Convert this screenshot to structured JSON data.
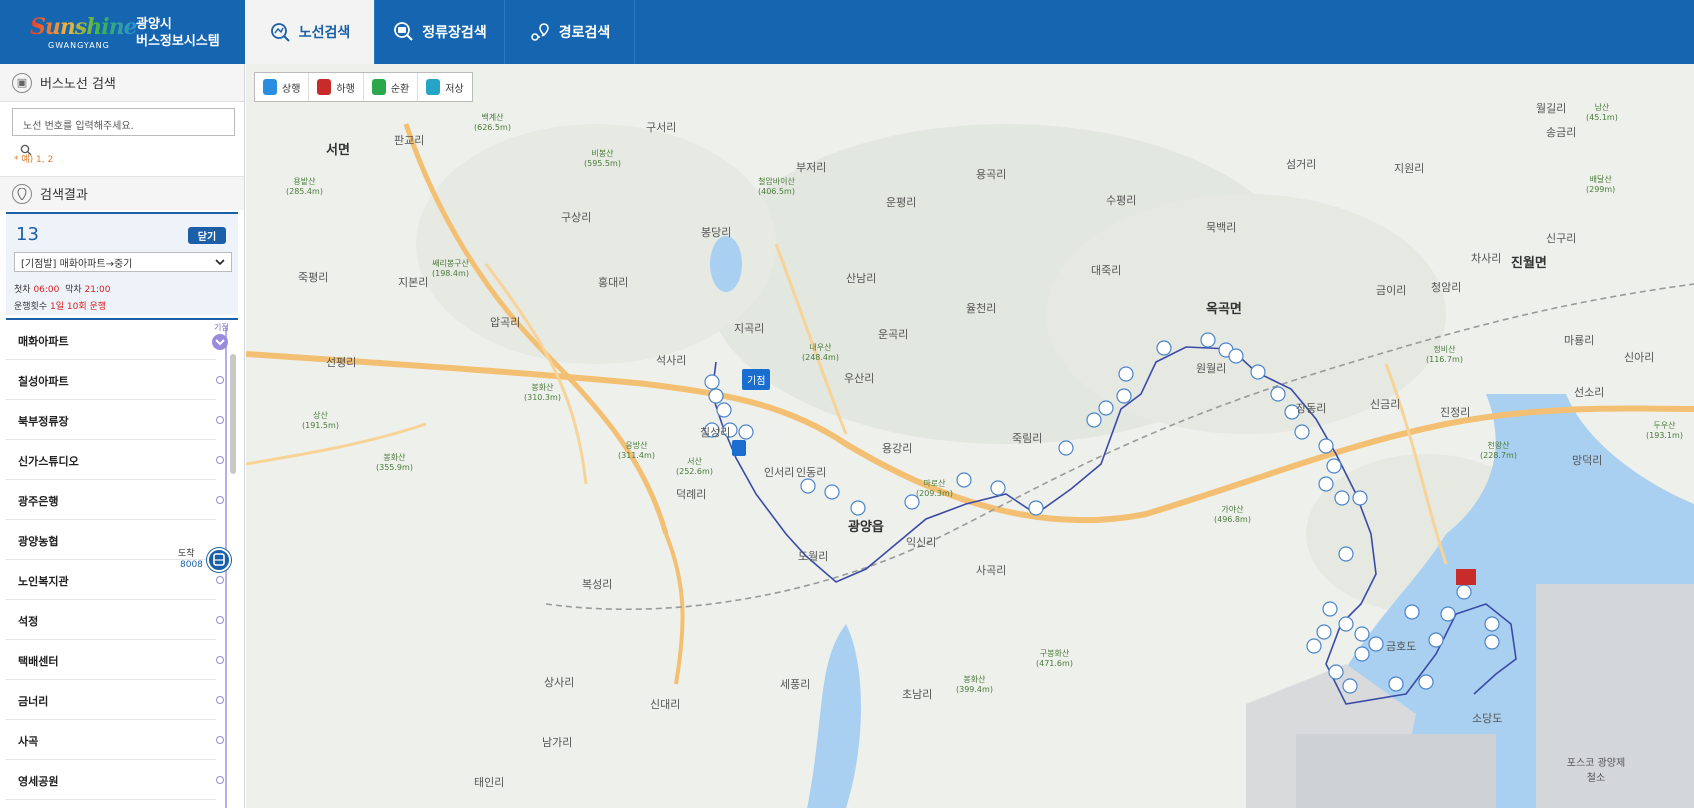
{
  "header": {
    "logo_word": "Sunshine",
    "logo_sub": "GWANGYANG",
    "title_line1": "광양시",
    "title_line2": "버스정보시스템",
    "tabs": [
      {
        "label": "노선검색",
        "active": true
      },
      {
        "label": "정류장검색",
        "active": false
      },
      {
        "label": "경로검색",
        "active": false
      }
    ]
  },
  "sidebar": {
    "search_title": "버스노선 검색",
    "search_placeholder": "노선 번호를 입력해주세요.",
    "search_hint": "* 예) 1, 2",
    "results_title": "검색결과",
    "route": {
      "number": "13",
      "close_label": "닫기",
      "direction": "[기점발] 매화아파트→중기",
      "first_label": "첫차",
      "first_time": "06:00",
      "last_label": "막차",
      "last_time": "21:00",
      "count_label": "운행횟수",
      "count_value": "1일 10회 운행"
    },
    "start_label": "기점",
    "arrive_label": "도착",
    "arrive_bus": "8008",
    "stops": [
      "매화아파트",
      "칠성아파트",
      "북부정류장",
      "신가스튜디오",
      "광주은행",
      "광양농협",
      "노인복지관",
      "석정",
      "택배센터",
      "금너리",
      "사곡",
      "영세공원"
    ]
  },
  "map": {
    "legend": [
      {
        "label": "상행",
        "color": "#2a8ee0"
      },
      {
        "label": "하행",
        "color": "#c92a2a"
      },
      {
        "label": "순환",
        "color": "#2aa84a"
      },
      {
        "label": "저상",
        "color": "#26a4c8"
      }
    ],
    "start_flag": "기점",
    "places": [
      {
        "name": "서면",
        "big": true
      },
      {
        "name": "판교리"
      },
      {
        "name": "구서리"
      },
      {
        "name": "부저리"
      },
      {
        "name": "용곡리"
      },
      {
        "name": "수평리"
      },
      {
        "name": "섬거리"
      },
      {
        "name": "지원리"
      },
      {
        "name": "월길리"
      },
      {
        "name": "송금리"
      },
      {
        "name": "구상리"
      },
      {
        "name": "봉당리"
      },
      {
        "name": "운평리"
      },
      {
        "name": "묵백리"
      },
      {
        "name": "대죽리"
      },
      {
        "name": "옥곡면",
        "big": true
      },
      {
        "name": "진월면",
        "big": true
      },
      {
        "name": "금이리"
      },
      {
        "name": "청암리"
      },
      {
        "name": "차사리"
      },
      {
        "name": "신구리"
      },
      {
        "name": "죽평리"
      },
      {
        "name": "지본리"
      },
      {
        "name": "홍대리"
      },
      {
        "name": "산남리"
      },
      {
        "name": "율천리"
      },
      {
        "name": "운곡리"
      },
      {
        "name": "압곡리"
      },
      {
        "name": "지곡리"
      },
      {
        "name": "석사리"
      },
      {
        "name": "우산리"
      },
      {
        "name": "선평리"
      },
      {
        "name": "원월리"
      },
      {
        "name": "장동리"
      },
      {
        "name": "신금리"
      },
      {
        "name": "진정리"
      },
      {
        "name": "마룡리"
      },
      {
        "name": "선소리"
      },
      {
        "name": "신아리"
      },
      {
        "name": "칠성리"
      },
      {
        "name": "용강리"
      },
      {
        "name": "죽림리"
      },
      {
        "name": "인서리"
      },
      {
        "name": "인동리"
      },
      {
        "name": "덕례리"
      },
      {
        "name": "광양읍",
        "big": true
      },
      {
        "name": "익신리"
      },
      {
        "name": "망덕리"
      },
      {
        "name": "도월리"
      },
      {
        "name": "사곡리"
      },
      {
        "name": "복성리"
      },
      {
        "name": "세풍리"
      },
      {
        "name": "초남리"
      },
      {
        "name": "신대리"
      },
      {
        "name": "상사리"
      },
      {
        "name": "남가리"
      },
      {
        "name": "금호도"
      },
      {
        "name": "태인리"
      },
      {
        "name": "소당도"
      },
      {
        "name": "포스코 광양제철소"
      }
    ],
    "peaks": [
      {
        "name": "백계산",
        "height": "(626.5m)"
      },
      {
        "name": "비봉산",
        "height": "(595.5m)"
      },
      {
        "name": "철암바이산",
        "height": "(406.5m)"
      },
      {
        "name": "용밭산",
        "height": "(285.4m)"
      },
      {
        "name": "쌔리봉구산",
        "height": "(198.4m)"
      },
      {
        "name": "내우산",
        "height": "(248.4m)"
      },
      {
        "name": "봉화산",
        "height": "(310.3m)"
      },
      {
        "name": "상산",
        "height": "(191.5m)"
      },
      {
        "name": "봉화산",
        "height": "(355.9m)"
      },
      {
        "name": "응방산",
        "height": "(311.4m)"
      },
      {
        "name": "서산",
        "height": "(252.6m)"
      },
      {
        "name": "마로산",
        "height": "(209.3m)"
      },
      {
        "name": "가야산",
        "height": "(496.8m)"
      },
      {
        "name": "구봉화산",
        "height": "(471.6m)"
      },
      {
        "name": "봉화산",
        "height": "(399.4m)"
      },
      {
        "name": "천왕산",
        "height": "(228.7m)"
      },
      {
        "name": "정비산",
        "height": "(116.7m)"
      },
      {
        "name": "남산",
        "height": "(45.1m)"
      },
      {
        "name": "배달산",
        "height": "(299m)"
      },
      {
        "name": "두우산",
        "height": "(193.1m)"
      }
    ]
  }
}
